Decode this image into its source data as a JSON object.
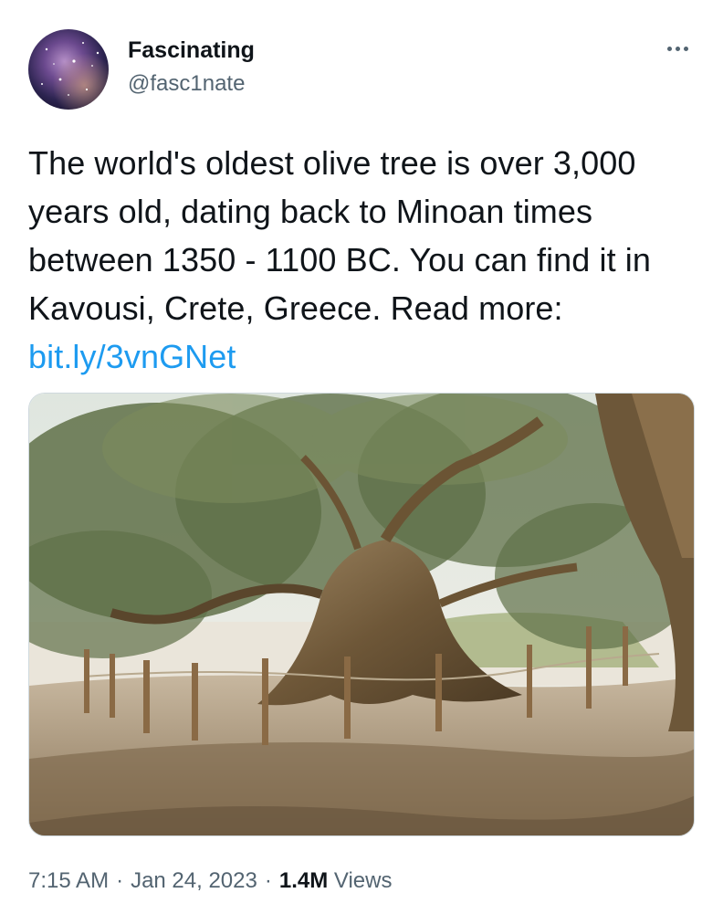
{
  "author": {
    "display_name": "Fascinating",
    "handle": "@fasc1nate",
    "avatar_icon": "galaxy-avatar"
  },
  "more_icon": "more-options-icon",
  "tweet": {
    "text_before_link": "The world's oldest olive tree is over 3,000 years old, dating back to Minoan times between 1350 - 1100 BC. You can find it in Kavousi, Crete, Greece. Read more: ",
    "link_text": "bit.ly/3vnGNet"
  },
  "meta": {
    "time": "7:15 AM",
    "date": "Jan 24, 2023",
    "views_count": "1.4M",
    "views_label": "Views",
    "separator": "·"
  },
  "colors": {
    "link": "#1d9bf0",
    "secondary_text": "#536471",
    "primary_text": "#0f1419"
  }
}
